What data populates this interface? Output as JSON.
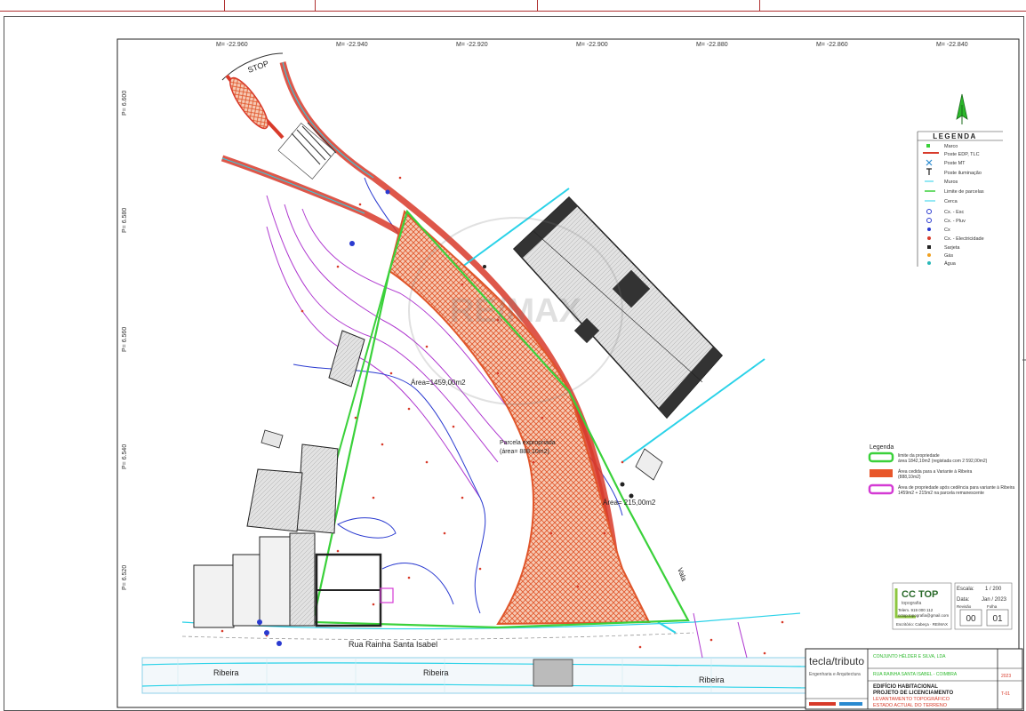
{
  "coords": {
    "x_labels": [
      "M= -22.960",
      "M= -22.940",
      "M= -22.920",
      "M= -22.900",
      "M= -22.880",
      "M= -22.860",
      "M= -22.840"
    ],
    "y_labels": [
      "P= 6.600",
      "P= 6.580",
      "P= 6.560",
      "P= 6.540",
      "P= 6.520"
    ]
  },
  "labels": {
    "stop": "STOP",
    "area_main": "Área=1459,00m2",
    "parcel": "Parcela expropriada",
    "parcel_area": "(área= 888,10m2)",
    "area_small": "Área= 215,00m2",
    "street": "Rua Rainha Santa Isabel",
    "river_1": "Ribeira",
    "river_2": "Ribeira",
    "river_3": "Ribeira",
    "vala": "Vala",
    "watermark": "RE/MAX"
  },
  "legend_top": {
    "title": "LEGENDA",
    "items": [
      {
        "icon": "green-square-icon",
        "text": "Marco"
      },
      {
        "icon": "red-arrow-icon",
        "text": "Poste EDP, TLC"
      },
      {
        "icon": "blue-x-icon",
        "text": "Poste MT"
      },
      {
        "icon": "lamp-post-icon",
        "text": "Poste iluminação"
      },
      {
        "icon": "cyan-line-icon",
        "text": "Muros"
      },
      {
        "icon": "green-line-icon",
        "text": "Limite de parcelas"
      },
      {
        "icon": "cyan-line-icon",
        "text": "Cerca"
      },
      {
        "icon": "blue-circle-icon",
        "text": "Cx. - Esc"
      },
      {
        "icon": "blue-circle-icon",
        "text": "Cx. - Pluv"
      },
      {
        "icon": "blue-dot-icon",
        "text": "Cx"
      },
      {
        "icon": "red-dot-icon",
        "text": "Cx. - Electricidade"
      },
      {
        "icon": "black-square-icon",
        "text": "Sarjeta"
      },
      {
        "icon": "orange-dot-icon",
        "text": "Gás"
      },
      {
        "icon": "teal-dot-icon",
        "text": "Água"
      }
    ]
  },
  "legend_bottom": {
    "title": "Legenda",
    "items": [
      {
        "color": "#3ad13a",
        "line1": "limite da propriedade",
        "line2": "área 1842,10m2 (registada com 2 592,00m2)"
      },
      {
        "color": "#e8562a",
        "line1": "Área cedida para a Variante à Ribeira",
        "line2": "(888,10m2)"
      },
      {
        "color": "#d43ad4",
        "line1": "Área de propriedade após cedência para variante à Ribeira",
        "line2": "1459m2 + 215m2 na parcela remanescente"
      }
    ]
  },
  "company": {
    "logo": "CC TOP",
    "sub": "topografia",
    "contact1": "Telem. 919 000 112",
    "contact2": "cctop.topografia@gmail.com",
    "footer": "Escritório: Cabeça · RE/MAX"
  },
  "scale_box": {
    "escala_label": "Escala:",
    "escala": "1 / 200",
    "data_label": "Data:",
    "data": "Jan / 2023",
    "rev_label": "Revisão",
    "rev": "00",
    "folha_label": "Folha",
    "folha": "01"
  },
  "title_block": {
    "brand": "tecla/tributo",
    "brand_sub": "Engenharia e Arquitectura",
    "owner_line": "CONJUNTO HÉLDER E SILVA, LDA",
    "location_line": "RUA RAINHA SANTA ISABEL - COIMBRA",
    "project_1": "EDIFÍCIO HABITACIONAL",
    "project_2": "PROJETO DE LICENCIAMENTO",
    "project_3": "LEVANTAMENTO TOPOGRÁFICO",
    "project_4": "ESTADO ACTUAL DO TERRENO",
    "code": "2023",
    "sheet_code": "T-01"
  }
}
